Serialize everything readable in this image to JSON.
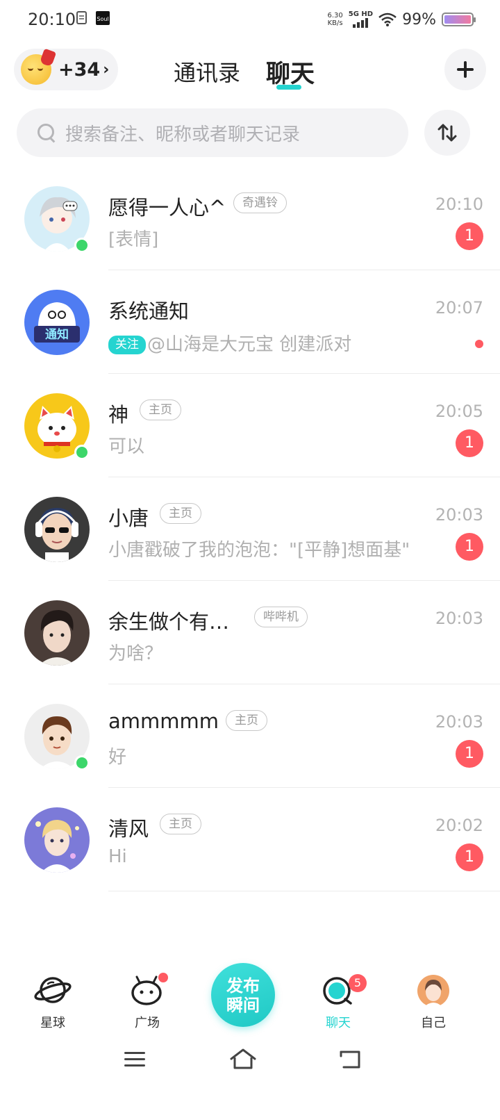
{
  "status_bar": {
    "time": "20:10",
    "net_speed_value": "6.30",
    "net_speed_unit": "KB/s",
    "net_type": "5G HD",
    "battery": "99%",
    "battery_level": 0.99
  },
  "header": {
    "mood_count": "+34",
    "tabs": [
      {
        "label": "通讯录",
        "active": false
      },
      {
        "label": "聊天",
        "active": true
      }
    ],
    "accent_color": "#25d4d0"
  },
  "search": {
    "placeholder": "搜索备注、昵称或者聊天记录"
  },
  "chats": [
    {
      "name": "愿得一人心^",
      "tag": "奇遇铃",
      "time": "20:10",
      "preview": "[表情]",
      "unread": "1",
      "online": true
    },
    {
      "name": "系统通知",
      "tag": "",
      "time": "20:07",
      "badge": "关注",
      "preview": "@山海是大元宝 创建派对",
      "unread": "",
      "dot": true,
      "online": false
    },
    {
      "name": "神",
      "tag": "主页",
      "time": "20:05",
      "preview": "可以",
      "unread": "1",
      "online": true
    },
    {
      "name": "小唐",
      "tag": "主页",
      "time": "20:03",
      "preview": "小唐戳破了我的泡泡：\"[平静]想面基\"",
      "unread": "1",
      "online": false
    },
    {
      "name": "余生做个有…",
      "tag": "哔哔机",
      "time": "20:03",
      "preview": "为啥？",
      "unread": "",
      "online": false
    },
    {
      "name": "ammmmm",
      "tag": "主页",
      "time": "20:03",
      "preview": "好",
      "unread": "1",
      "online": true
    },
    {
      "name": "清风",
      "tag": "主页",
      "time": "20:02",
      "preview": "Hi",
      "unread": "1",
      "online": false
    }
  ],
  "system_avatar_text": "通知",
  "tabbar": {
    "items": [
      {
        "label": "星球",
        "icon": "planet-icon"
      },
      {
        "label": "广场",
        "icon": "square-icon",
        "dot": true
      },
      {
        "label": "发布瞬间",
        "icon": "publish-button"
      },
      {
        "label": "聊天",
        "icon": "chat-icon",
        "badge": "5",
        "active": true
      },
      {
        "label": "自己",
        "icon": "profile-avatar"
      }
    ],
    "publish_line1": "发布",
    "publish_line2": "瞬间"
  }
}
